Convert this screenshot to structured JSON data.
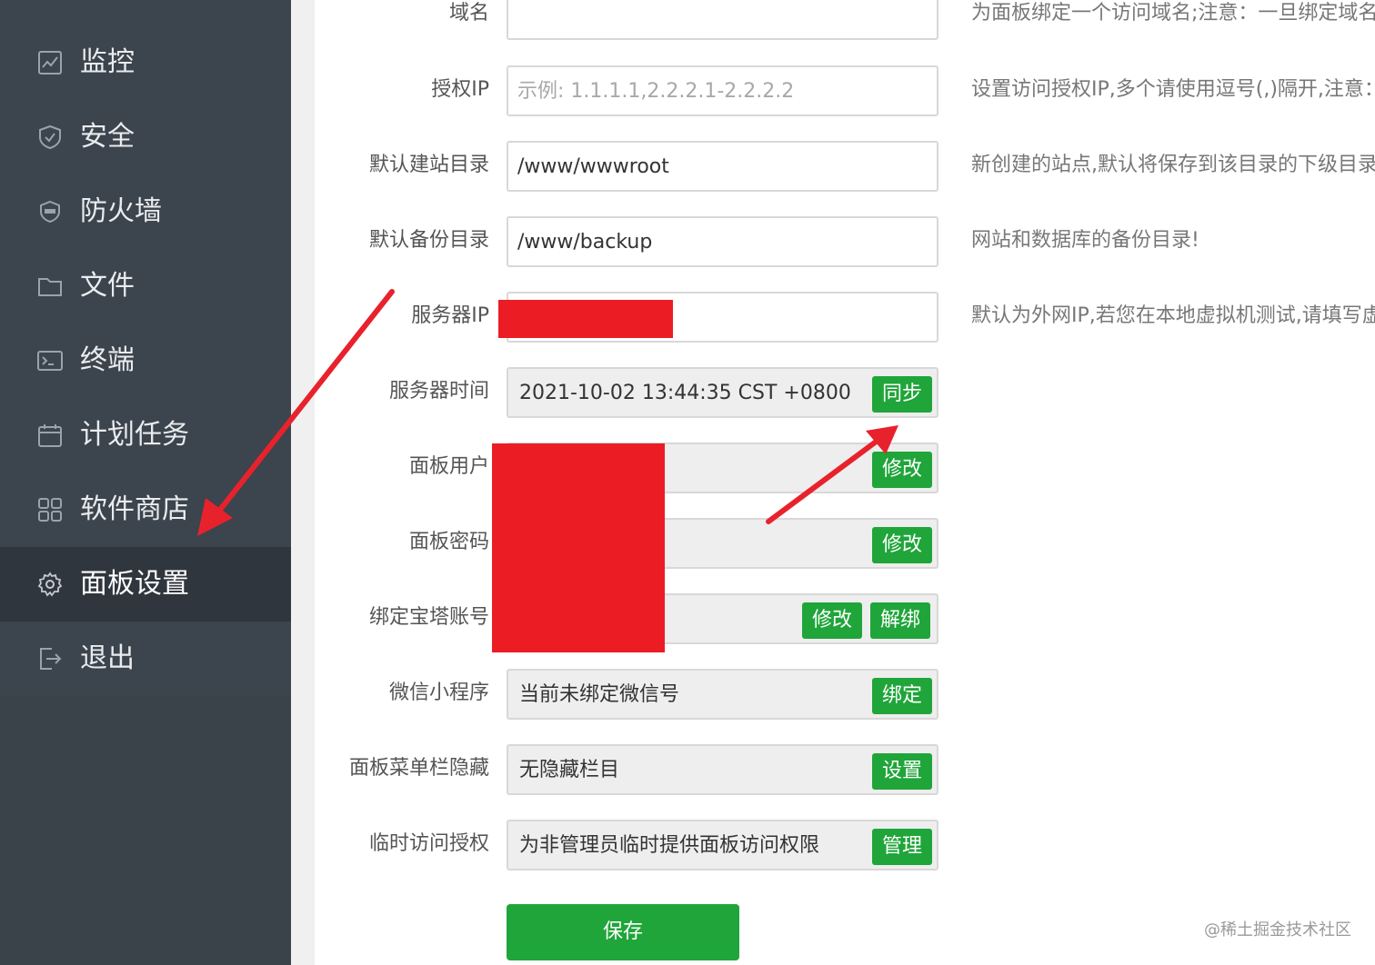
{
  "sidebar": {
    "items": [
      {
        "label": "监控",
        "icon": "monitor-icon"
      },
      {
        "label": "安全",
        "icon": "shield-icon"
      },
      {
        "label": "防火墙",
        "icon": "waf-shield-icon"
      },
      {
        "label": "文件",
        "icon": "folder-icon"
      },
      {
        "label": "终端",
        "icon": "terminal-icon"
      },
      {
        "label": "计划任务",
        "icon": "calendar-icon"
      },
      {
        "label": "软件商店",
        "icon": "grid-icon"
      },
      {
        "label": "面板设置",
        "icon": "gear-icon",
        "active": true
      },
      {
        "label": "退出",
        "icon": "logout-icon"
      }
    ]
  },
  "settings": {
    "domain": {
      "label": "域名",
      "value": "",
      "hint": "为面板绑定一个访问域名;注意：一旦绑定域名"
    },
    "auth_ip": {
      "label": "授权IP",
      "placeholder": "示例: 1.1.1.1,2.2.2.1-2.2.2.2",
      "hint": "设置访问授权IP,多个请使用逗号(,)隔开,注意："
    },
    "site_dir": {
      "label": "默认建站目录",
      "value": "/www/wwwroot",
      "hint": "新创建的站点,默认将保存到该目录的下级目录"
    },
    "backup_dir": {
      "label": "默认备份目录",
      "value": "/www/backup",
      "hint": "网站和数据库的备份目录!"
    },
    "server_ip": {
      "label": "服务器IP",
      "hint": "默认为外网IP,若您在本地虚拟机测试,请填写虚"
    },
    "server_time": {
      "label": "服务器时间",
      "value": "2021-10-02 13:44:35 CST +0800",
      "button": "同步"
    },
    "panel_user": {
      "label": "面板用户",
      "button": "修改"
    },
    "panel_password": {
      "label": "面板密码",
      "button": "修改"
    },
    "bt_account": {
      "label": "绑定宝塔账号",
      "button_modify": "修改",
      "button_unbind": "解绑"
    },
    "wechat": {
      "label": "微信小程序",
      "value": "当前未绑定微信号",
      "button": "绑定"
    },
    "menu_hide": {
      "label": "面板菜单栏隐藏",
      "value": "无隐藏栏目",
      "button": "设置"
    },
    "temp_access": {
      "label": "临时访问授权",
      "value": "为非管理员临时提供面板访问权限",
      "button": "管理"
    }
  },
  "save_label": "保存",
  "watermark": "@稀土掘金技术社区",
  "colors": {
    "accent": "#20a53a",
    "sidebar": "#3c444d",
    "annotation": "#e8222c"
  }
}
